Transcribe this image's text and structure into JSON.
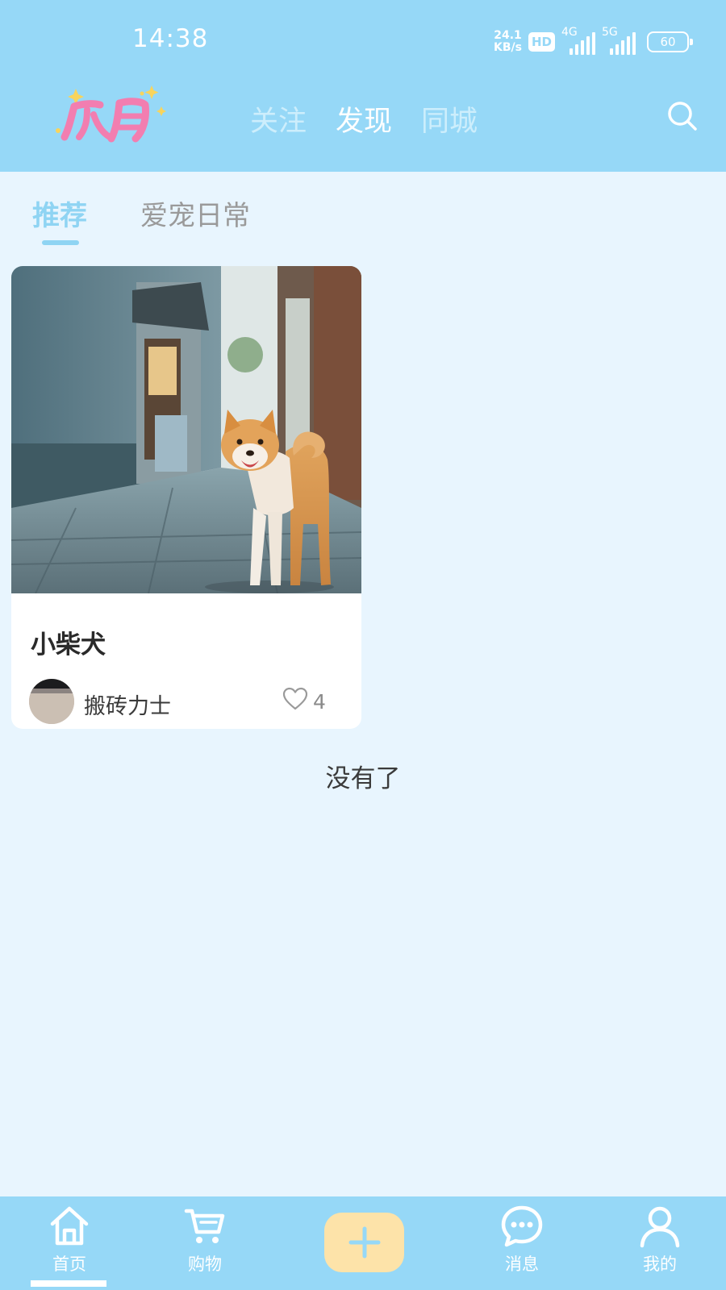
{
  "status_bar": {
    "time": "14:38",
    "net_speed_value": "24.1",
    "net_speed_unit": "KB/s",
    "hd_badge": "HD",
    "sim1_type": "4G",
    "sim2_type": "5G",
    "battery": "60"
  },
  "header": {
    "logo_text": "爪月",
    "tabs": [
      {
        "label": "关注",
        "active": false
      },
      {
        "label": "发现",
        "active": true
      },
      {
        "label": "同城",
        "active": false
      }
    ]
  },
  "sub_tabs": [
    {
      "label": "推荐",
      "active": true
    },
    {
      "label": "爱宠日常",
      "active": false
    }
  ],
  "feed": {
    "cards": [
      {
        "title": "小柴犬",
        "author": "搬砖力士",
        "likes": "4"
      }
    ],
    "end_text": "没有了"
  },
  "bottom_nav": {
    "items": [
      {
        "label": "首页",
        "icon": "home-icon",
        "active": true
      },
      {
        "label": "购物",
        "icon": "cart-icon",
        "active": false
      },
      {
        "label": "",
        "icon": "plus-icon",
        "active": false
      },
      {
        "label": "消息",
        "icon": "message-icon",
        "active": false
      },
      {
        "label": "我的",
        "icon": "user-icon",
        "active": false
      }
    ]
  },
  "colors": {
    "header_bg": "#96d8f7",
    "page_bg": "#e8f5fe",
    "accent": "#8fd4f3",
    "fab_bg": "#fde3a9",
    "logo_pink": "#f27eb0",
    "logo_star": "#f8d45c"
  }
}
